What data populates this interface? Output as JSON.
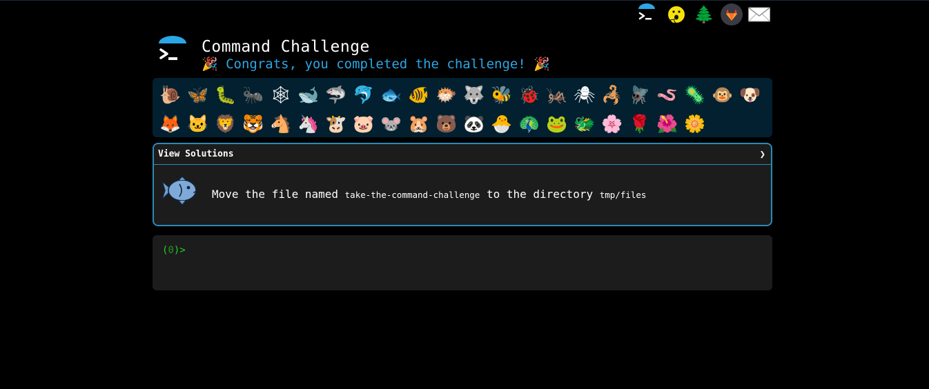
{
  "header": {
    "title": "Command Challenge",
    "subtitle": "🎉 Congrats, you completed the challenge! 🎉"
  },
  "topbar": {
    "icons": [
      "terminal-logo-icon",
      "emoji-face-icon",
      "tree-icon",
      "gitlab-icon",
      "mail-icon"
    ],
    "tree_glyph": "🌲",
    "mail_glyph": "✉"
  },
  "collection": {
    "animals": [
      {
        "name": "snail",
        "glyph": "🐌"
      },
      {
        "name": "butterfly",
        "glyph": "🦋"
      },
      {
        "name": "bug",
        "glyph": "🐛"
      },
      {
        "name": "ant",
        "glyph": "🐜"
      },
      {
        "name": "spider-web",
        "glyph": "🕸"
      },
      {
        "name": "whale",
        "glyph": "🐋"
      },
      {
        "name": "shark",
        "glyph": "🦈"
      },
      {
        "name": "dolphin",
        "glyph": "🐬"
      },
      {
        "name": "fish",
        "glyph": "🐟"
      },
      {
        "name": "tropical-fish",
        "glyph": "🐠"
      },
      {
        "name": "blowfish",
        "glyph": "🐡"
      },
      {
        "name": "wolf",
        "glyph": "🐺"
      },
      {
        "name": "bee",
        "glyph": "🐝"
      },
      {
        "name": "lady-beetle",
        "glyph": "🐞"
      },
      {
        "name": "cricket",
        "glyph": "🦗"
      },
      {
        "name": "spider",
        "glyph": "🕷"
      },
      {
        "name": "scorpion",
        "glyph": "🦂"
      },
      {
        "name": "fly",
        "glyph": "🪰"
      },
      {
        "name": "worm",
        "glyph": "🪱"
      },
      {
        "name": "microbe",
        "glyph": "🦠"
      },
      {
        "name": "monkey",
        "glyph": "🐵"
      },
      {
        "name": "dog",
        "glyph": "🐶"
      },
      {
        "name": "fox",
        "glyph": "🦊"
      },
      {
        "name": "cat",
        "glyph": "🐱"
      },
      {
        "name": "lion",
        "glyph": "🦁"
      },
      {
        "name": "tiger",
        "glyph": "🐯"
      },
      {
        "name": "horse",
        "glyph": "🐴"
      },
      {
        "name": "unicorn",
        "glyph": "🦄"
      },
      {
        "name": "cow",
        "glyph": "🐮"
      },
      {
        "name": "pig",
        "glyph": "🐷"
      },
      {
        "name": "mouse",
        "glyph": "🐭"
      },
      {
        "name": "hamster",
        "glyph": "🐹"
      },
      {
        "name": "bear",
        "glyph": "🐻"
      },
      {
        "name": "panda",
        "glyph": "🐼"
      },
      {
        "name": "hatching-chick",
        "glyph": "🐣"
      },
      {
        "name": "peacock",
        "glyph": "🦚"
      },
      {
        "name": "frog",
        "glyph": "🐸"
      },
      {
        "name": "dragon",
        "glyph": "🐲"
      },
      {
        "name": "cherry-blossom",
        "glyph": "🌸"
      },
      {
        "name": "rose",
        "glyph": "🌹"
      },
      {
        "name": "hibiscus",
        "glyph": "🌺"
      },
      {
        "name": "sunflower",
        "glyph": "🌼"
      }
    ]
  },
  "panel": {
    "header_label": "View Solutions",
    "chevron": "❯",
    "challenge": {
      "prefix": "Move the file named ",
      "file_name": "take-the-command-challenge",
      "middle": " to the directory ",
      "directory": "tmp/files"
    }
  },
  "terminal": {
    "prompt_open": "(",
    "prompt_count": "0",
    "prompt_close": ")>",
    "input_value": ""
  },
  "colors": {
    "background": "#000000",
    "accent": "#2ba7e6",
    "panel_border": "#2a8bb8",
    "collection_bg": "#02202f",
    "prompt_green": "#27d127"
  }
}
